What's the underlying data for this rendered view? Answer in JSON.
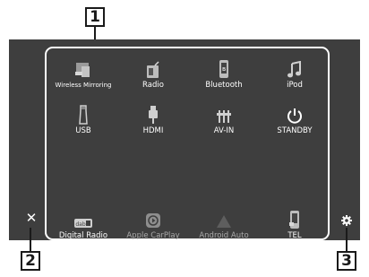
{
  "callouts": [
    "1",
    "2",
    "3"
  ],
  "sources": [
    {
      "id": "wireless-mirroring",
      "label": "Wireless Mirroring",
      "icon": "wireless-mirroring-icon"
    },
    {
      "id": "radio",
      "label": "Radio",
      "icon": "radio-icon"
    },
    {
      "id": "bluetooth",
      "label": "Bluetooth",
      "icon": "bluetooth-icon"
    },
    {
      "id": "ipod",
      "label": "iPod",
      "icon": "music-note-icon"
    },
    {
      "id": "usb",
      "label": "USB",
      "icon": "usb-stick-icon"
    },
    {
      "id": "hdmi",
      "label": "HDMI",
      "icon": "hdmi-plug-icon"
    },
    {
      "id": "av-in",
      "label": "AV-IN",
      "icon": "av-in-icon"
    },
    {
      "id": "standby",
      "label": "STANDBY",
      "icon": "power-icon"
    },
    {
      "id": "digital-radio",
      "label": "Digital Radio",
      "icon": "dab-icon"
    },
    {
      "id": "apple-carplay",
      "label": "Apple CarPlay",
      "icon": "carplay-icon"
    },
    {
      "id": "android-auto",
      "label": "Android Auto",
      "icon": "android-auto-icon"
    },
    {
      "id": "tel",
      "label": "TEL",
      "icon": "phone-icon"
    }
  ],
  "close_icon": "close-icon",
  "settings_icon": "gear-icon",
  "colors": {
    "screen": "#3e3e3e",
    "text": "#ffffff",
    "dimmed": "#a9a9a9",
    "callout_border": "#1a1a1a"
  }
}
